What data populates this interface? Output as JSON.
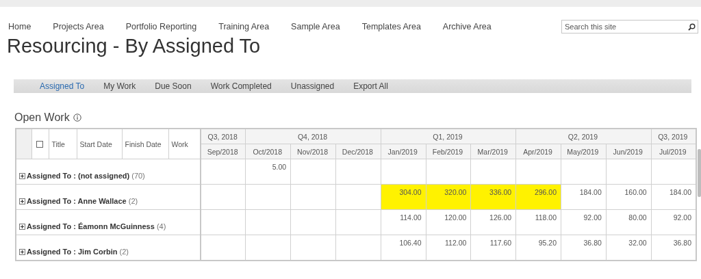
{
  "nav": {
    "items": [
      {
        "label": "Home"
      },
      {
        "label": "Projects Area"
      },
      {
        "label": "Portfolio Reporting"
      },
      {
        "label": "Training Area"
      },
      {
        "label": "Sample Area"
      },
      {
        "label": "Templates Area"
      },
      {
        "label": "Archive Area"
      }
    ],
    "search": {
      "placeholder": "Search this site"
    }
  },
  "page_title": "Resourcing - By Assigned To",
  "tabs": [
    {
      "label": "Assigned To",
      "selected": true
    },
    {
      "label": "My Work",
      "selected": false
    },
    {
      "label": "Due Soon",
      "selected": false
    },
    {
      "label": "Work Completed",
      "selected": false
    },
    {
      "label": "Unassigned",
      "selected": false
    },
    {
      "label": "Export All",
      "selected": false
    }
  ],
  "section_title": "Open Work",
  "table": {
    "select_all_checked": false,
    "columns": [
      "Title",
      "Start Date",
      "Finish Date",
      "Work"
    ],
    "quarters": [
      {
        "label": "Q3, 2018",
        "months": [
          "Sep/2018"
        ]
      },
      {
        "label": "Q4, 2018",
        "months": [
          "Oct/2018",
          "Nov/2018",
          "Dec/2018"
        ]
      },
      {
        "label": "Q1, 2019",
        "months": [
          "Jan/2019",
          "Feb/2019",
          "Mar/2019"
        ]
      },
      {
        "label": "Q2, 2019",
        "months": [
          "Apr/2019",
          "May/2019",
          "Jun/2019"
        ]
      },
      {
        "label": "Q3, 2019",
        "months": [
          "Jul/2019"
        ]
      }
    ],
    "groups": [
      {
        "label": "Assigned To :",
        "name": "(not assigned)",
        "count": "(70)",
        "cells": [
          null,
          {
            "value": "5.00",
            "highlighted": false
          },
          null,
          null,
          null,
          null,
          null,
          null,
          null,
          null,
          null
        ]
      },
      {
        "label": "Assigned To :",
        "name": "Anne Wallace",
        "count": "(2)",
        "cells": [
          null,
          null,
          null,
          null,
          {
            "value": "304.00",
            "highlighted": true
          },
          {
            "value": "320.00",
            "highlighted": true
          },
          {
            "value": "336.00",
            "highlighted": true
          },
          {
            "value": "296.00",
            "highlighted": true
          },
          {
            "value": "184.00",
            "highlighted": false
          },
          {
            "value": "160.00",
            "highlighted": false
          },
          {
            "value": "184.00",
            "highlighted": false
          }
        ]
      },
      {
        "label": "Assigned To :",
        "name": "Éamonn McGuinness",
        "count": "(4)",
        "cells": [
          null,
          null,
          null,
          null,
          {
            "value": "114.00",
            "highlighted": false
          },
          {
            "value": "120.00",
            "highlighted": false
          },
          {
            "value": "126.00",
            "highlighted": false
          },
          {
            "value": "118.00",
            "highlighted": false
          },
          {
            "value": "92.00",
            "highlighted": false
          },
          {
            "value": "80.00",
            "highlighted": false
          },
          {
            "value": "92.00",
            "highlighted": false
          }
        ]
      },
      {
        "label": "Assigned To :",
        "name": "Jim Corbin",
        "count": "(2)",
        "cells": [
          null,
          null,
          null,
          null,
          {
            "value": "106.40",
            "highlighted": false
          },
          {
            "value": "112.00",
            "highlighted": false
          },
          {
            "value": "117.60",
            "highlighted": false
          },
          {
            "value": "95.20",
            "highlighted": false
          },
          {
            "value": "36.80",
            "highlighted": false
          },
          {
            "value": "32.00",
            "highlighted": false
          },
          {
            "value": "36.80",
            "highlighted": false
          }
        ]
      }
    ]
  }
}
